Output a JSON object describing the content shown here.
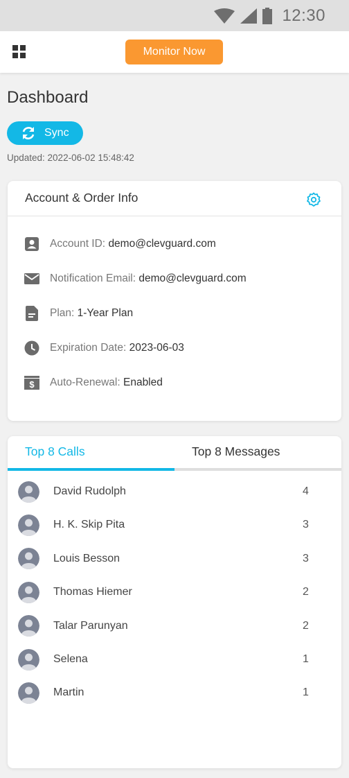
{
  "status_bar": {
    "time": "12:30",
    "icons": [
      "wifi-icon",
      "cell-signal-icon",
      "battery-icon"
    ]
  },
  "app_bar": {
    "menu_icon": "grid-icon",
    "monitor_button": "Monitor Now",
    "accent": "#fa9831"
  },
  "page": {
    "title": "Dashboard",
    "sync_label": "Sync",
    "updated": "Updated: 2022-06-02 15:48:42",
    "accent": "#13b8e6"
  },
  "account_card": {
    "title": "Account & Order Info",
    "settings_icon": "gear-icon",
    "rows": [
      {
        "icon": "account-box-icon",
        "label": "Account ID: ",
        "value": "demo@clevguard.com"
      },
      {
        "icon": "mail-icon",
        "label": "Notification Email: ",
        "value": "demo@clevguard.com"
      },
      {
        "icon": "document-icon",
        "label": "Plan: ",
        "value": "1-Year Plan"
      },
      {
        "icon": "clock-icon",
        "label": "Expiration Date: ",
        "value": "2023-06-03"
      },
      {
        "icon": "dollar-icon",
        "label": "Auto-Renewal: ",
        "value": "Enabled"
      }
    ]
  },
  "top_card": {
    "tabs": [
      {
        "label": "Top 8 Calls",
        "active": true
      },
      {
        "label": "Top 8 Messages",
        "active": false
      }
    ],
    "calls": [
      {
        "name": "David Rudolph",
        "count": "4"
      },
      {
        "name": "H. K. Skip Pita",
        "count": "3"
      },
      {
        "name": "Louis Besson",
        "count": "3"
      },
      {
        "name": "Thomas Hiemer",
        "count": "2"
      },
      {
        "name": "Talar Parunyan",
        "count": "2"
      },
      {
        "name": "Selena",
        "count": "1"
      },
      {
        "name": "Martin",
        "count": "1"
      }
    ]
  }
}
